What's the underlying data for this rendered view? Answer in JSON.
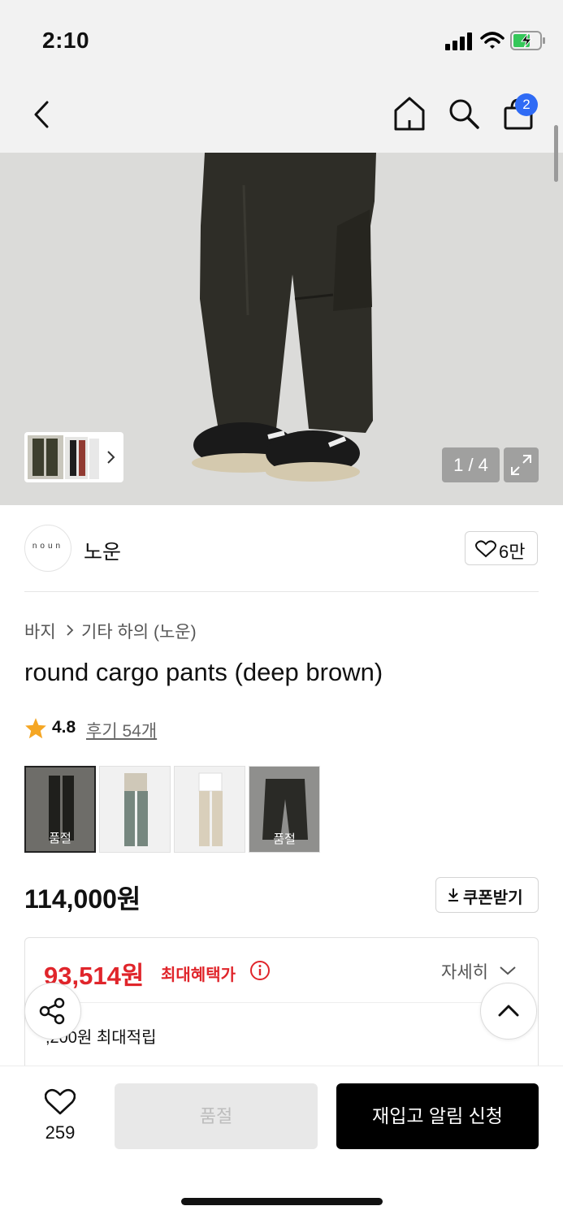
{
  "status_bar": {
    "time": "2:10"
  },
  "header": {
    "cart_count": "2"
  },
  "gallery": {
    "counter": "1 / 4"
  },
  "brand": {
    "logo_text": "noun",
    "name": "노운",
    "like_count": "6만"
  },
  "breadcrumb": {
    "items": [
      "바지",
      "기타 하의 (노운)"
    ]
  },
  "product": {
    "title": "round cargo pants (deep brown)",
    "rating": "4.8",
    "review_link": "후기 54개",
    "price": "114,000원",
    "coupon_label": "쿠폰받기"
  },
  "color_options": [
    {
      "sold_out_label": "품절"
    },
    {
      "sold_out_label": ""
    },
    {
      "sold_out_label": ""
    },
    {
      "sold_out_label": "품절"
    }
  ],
  "benefit": {
    "max_price": "93,514원",
    "max_price_label": "최대혜택가",
    "detail_label": "자세히",
    "points_text": ",200원 최대적립"
  },
  "bottom_bar": {
    "wish_count": "259",
    "soldout_label": "품절",
    "restock_label": "재입고 알림 신청"
  },
  "colors": {
    "accent_red": "#e0252b",
    "badge_blue": "#2f6bf5",
    "restock_bg": "#000000"
  }
}
